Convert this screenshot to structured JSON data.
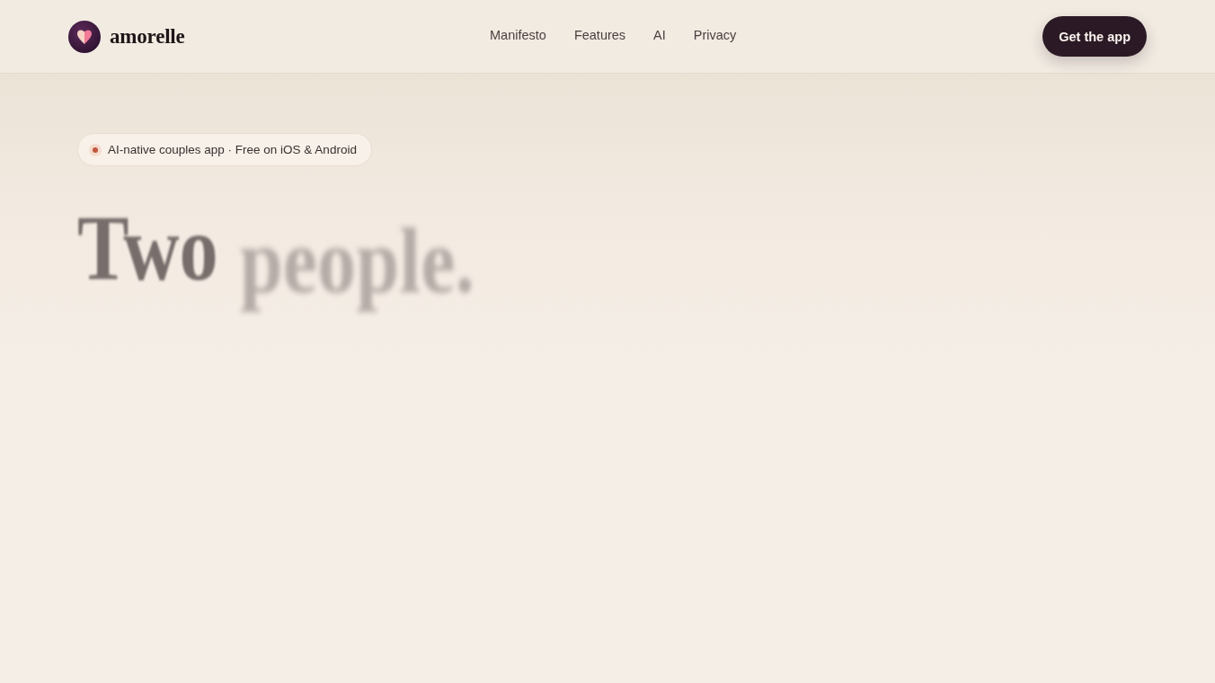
{
  "header": {
    "logo": {
      "wordmark": "amorelle"
    },
    "nav": [
      "Manifesto",
      "Features",
      "AI",
      "Privacy"
    ],
    "cta": "Get the app"
  },
  "hero": {
    "badge": "AI-native couples app · Free on iOS & Android",
    "headline": [
      {
        "text": "Two",
        "kind": "settling"
      },
      {
        "text": "people.",
        "kind": "entering"
      }
    ]
  }
}
